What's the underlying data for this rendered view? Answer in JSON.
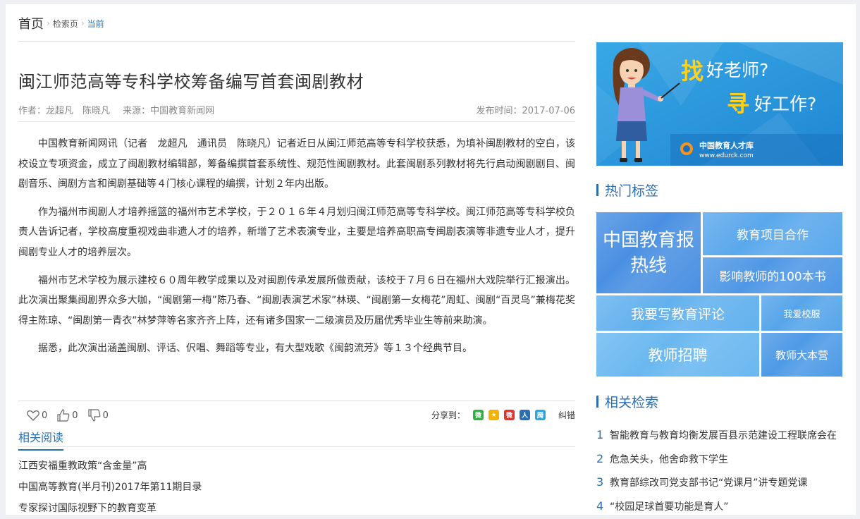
{
  "breadcrumb": {
    "home": "首页",
    "search": "检索页",
    "current": "当前"
  },
  "article": {
    "title": "闽江师范高等专科学校筹备编写首套闽剧教材",
    "author": "作者：龙超凡　陈晓凡",
    "source": "来源：中国教育新闻网",
    "date": "发布时间：2017-07-06",
    "paragraphs": [
      "中国教育新闻网讯（记者　龙超凡　通讯员　陈晓凡）记者近日从闽江师范高等专科学校获悉，为填补闽剧教材的空白，该校设立专项资金，成立了闽剧教材编辑部，筹备编撰首套系统性、规范性闽剧教材。此套闽剧系列教材将先行启动闽剧剧目、闽剧音乐、闽剧方言和闽剧基础等４门核心课程的编撰，计划２年内出版。",
      "作为福州市闽剧人才培养摇篮的福州市艺术学校，于２０１６年４月划归闽江师范高等专科学校。闽江师范高等专科学校负责人告诉记者，学校高度重视戏曲非遗人才的培养，新增了艺术表演专业，主要是培养高职高专闽剧表演等非遗专业人才，提升闽剧专业人才的培养层次。",
      "福州市艺术学校为展示建校６０周年教学成果以及对闽剧传承发展所做贡献，该校于７月６日在福州大戏院举行汇报演出。此次演出聚集闽剧界众多大咖，“闽剧第一梅”陈乃春、“闽剧表演艺术家”林瑛、“闽剧第一女梅花”周虹、闽剧“百灵鸟”兼梅花奖得主陈琼、“闽剧第一青衣”林梦萍等名家齐齐上阵，还有诸多国家一二级演员及历届优秀毕业生等前来助演。",
      "据悉，此次演出涵盖闽剧、评话、伬唱、舞蹈等专业，有大型戏歌《闽韵流芳》等１３个经典节目。"
    ]
  },
  "actions": {
    "like": "0",
    "up": "0",
    "down": "0",
    "share_label": "分享到：",
    "correct": "纠错"
  },
  "related_reading": {
    "tab": "相关阅读",
    "items": [
      "江西安福重教政策“含金量”高",
      "中国高等教育(半月刊)2017年第11期目录",
      "专家探讨国际视野下的教育变革"
    ]
  },
  "banner": {
    "line1_big": "找",
    "line1": "好老师?",
    "line2_big": "寻",
    "line2": "好工作?",
    "logo_name": "中国教育人才库",
    "logo_url": "www.edurck.com"
  },
  "hot_tags": {
    "title": "热门标签",
    "tags": [
      {
        "label": "中国教育报热线",
        "color": "#4a90e2"
      },
      {
        "label": "教育项目合作",
        "color": "#5aa8ec"
      },
      {
        "label": "影响教师的100本书",
        "color": "#4f98e6"
      },
      {
        "label": "我要写教育评论",
        "color": "#62b1ee"
      },
      {
        "label": "我爱校服",
        "color": "#56a5ea"
      },
      {
        "label": "教师招聘",
        "color": "#6ab8f0"
      },
      {
        "label": "教师大本营",
        "color": "#4e9ae6"
      }
    ]
  },
  "related_search": {
    "title": "相关检索",
    "items": [
      {
        "n": "1",
        "text": "智能教育与教育均衡发展百县示范建设工程联席会在"
      },
      {
        "n": "2",
        "text": "危急关头，他舍命救下学生"
      },
      {
        "n": "3",
        "text": "教育部综改司党支部书记“党课月”讲专题党课"
      },
      {
        "n": "4",
        "text": "“校园足球首要功能是育人”"
      }
    ]
  }
}
